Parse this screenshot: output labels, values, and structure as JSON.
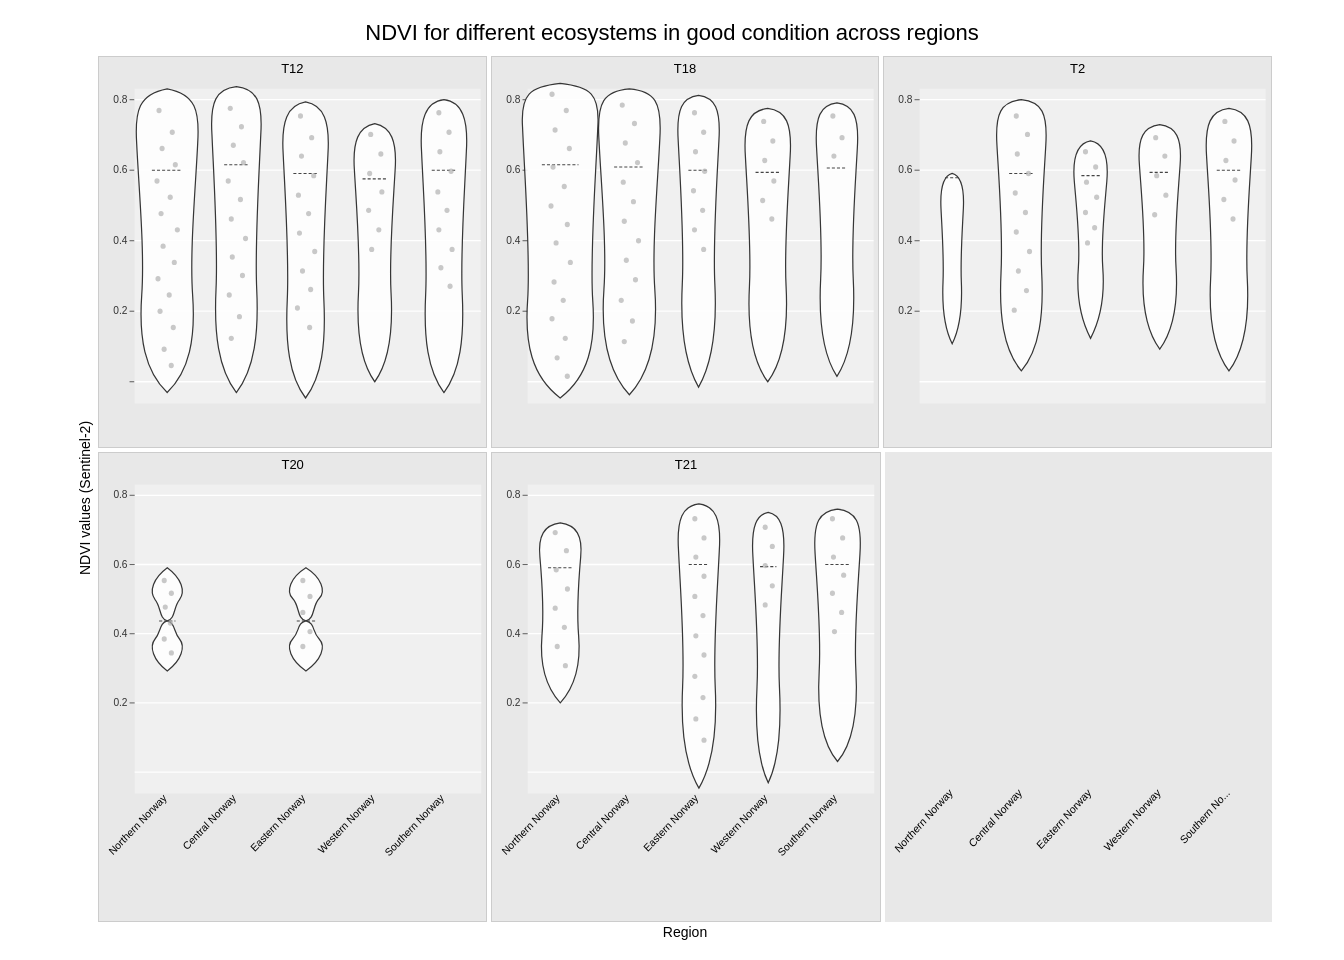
{
  "title": "NDVI for different ecosystems in good condition across regions",
  "yAxisLabel": "NDVI values (Sentinel-2)",
  "xAxisLabel": "Region",
  "panels": [
    {
      "id": "T12",
      "row": 0,
      "col": 0
    },
    {
      "id": "T18",
      "row": 0,
      "col": 1
    },
    {
      "id": "T2",
      "row": 0,
      "col": 2
    },
    {
      "id": "T20",
      "row": 1,
      "col": 0
    },
    {
      "id": "T21",
      "row": 1,
      "col": 1
    },
    {
      "id": "legend",
      "row": 1,
      "col": 2
    }
  ],
  "regions": [
    "Northern Norway",
    "Central Norway",
    "Eastern Norway",
    "Western Norway",
    "Southern Norway"
  ],
  "yTicks": [
    "0.2",
    "0.4",
    "0.6",
    "0.8"
  ],
  "colors": {
    "background": "#e8e8e8",
    "plotArea": "#f0f0f0",
    "violin": "#ffffff",
    "violinStroke": "#000000",
    "dots": "#c0c0c0",
    "gridLine": "#ffffff"
  }
}
